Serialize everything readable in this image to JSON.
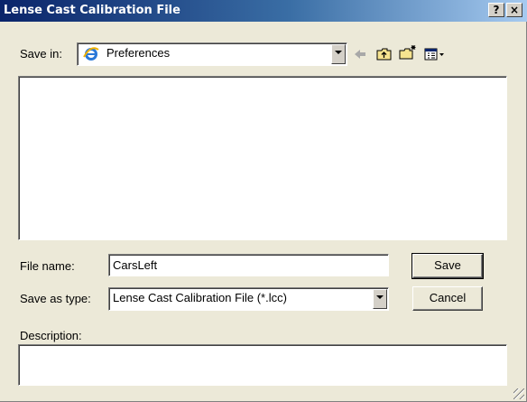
{
  "window": {
    "title": "Lense Cast Calibration File",
    "help_label": "?",
    "close_label": "×"
  },
  "toolbar": {
    "save_in_label": "Save in:",
    "save_in_value": "Preferences",
    "icons": [
      "back-arrow-icon",
      "up-folder-icon",
      "new-folder-icon",
      "view-menu-icon"
    ]
  },
  "form": {
    "file_name_label": "File name:",
    "file_name_value": "CarsLeft",
    "save_as_type_label": "Save as type:",
    "save_as_type_value": "Lense Cast Calibration File (*.lcc)",
    "description_label": "Description:",
    "description_value": ""
  },
  "buttons": {
    "save": "Save",
    "cancel": "Cancel"
  }
}
